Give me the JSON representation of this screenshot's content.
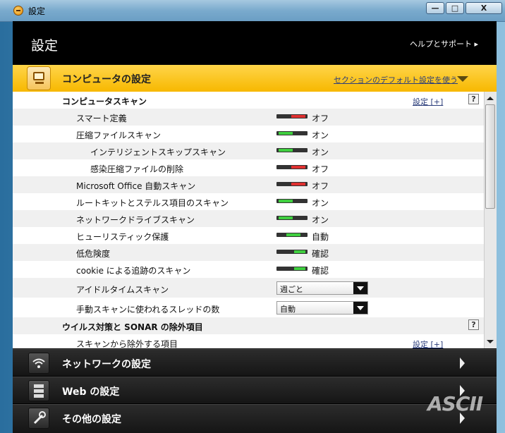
{
  "window": {
    "title": "設定",
    "min_glyph": "—",
    "max_glyph": "□",
    "close_glyph": "X"
  },
  "header": {
    "title": "設定",
    "help": "ヘルプとサポート ▸"
  },
  "section": {
    "title": "コンピュータの設定",
    "defaults_link": "セクションのデフォルト設定を使う"
  },
  "scan": {
    "heading": "コンピュータスキャン",
    "settings_link": "設定 [+]",
    "help": "?",
    "rows": [
      {
        "label": "スマート定義",
        "state": "オフ"
      },
      {
        "label": "圧縮ファイルスキャン",
        "state": "オン"
      },
      {
        "label": "インテリジェントスキップスキャン",
        "state": "オン"
      },
      {
        "label": "感染圧縮ファイルの削除",
        "state": "オフ"
      },
      {
        "label": "Microsoft Office 自動スキャン",
        "state": "オフ"
      },
      {
        "label": "ルートキットとステルス項目のスキャン",
        "state": "オン"
      },
      {
        "label": "ネットワークドライブスキャン",
        "state": "オン"
      },
      {
        "label": "ヒューリスティック保護",
        "state": "自動"
      },
      {
        "label": "低危険度",
        "state": "確認"
      },
      {
        "label": "cookie による追跡のスキャン",
        "state": "確認"
      }
    ],
    "dropdowns": [
      {
        "label": "アイドルタイムスキャン",
        "value": "週ごと"
      },
      {
        "label": "手動スキャンに使われるスレッドの数",
        "value": "自動"
      }
    ]
  },
  "exclusions": {
    "heading": "ウイルス対策と SONAR の除外項目",
    "help": "?",
    "row_label": "スキャンから除外する項目",
    "settings_link": "設定 [+]"
  },
  "bottom": [
    {
      "title": "ネットワークの設定",
      "icon": "wifi-icon"
    },
    {
      "title": "Web の設定",
      "icon": "server-icon"
    },
    {
      "title": "その他の設定",
      "icon": "wrench-icon"
    }
  ],
  "watermark": "ASCII",
  "colors": {
    "accent": "#f7b800",
    "on": "#3fcf3f",
    "off": "#e03030"
  }
}
